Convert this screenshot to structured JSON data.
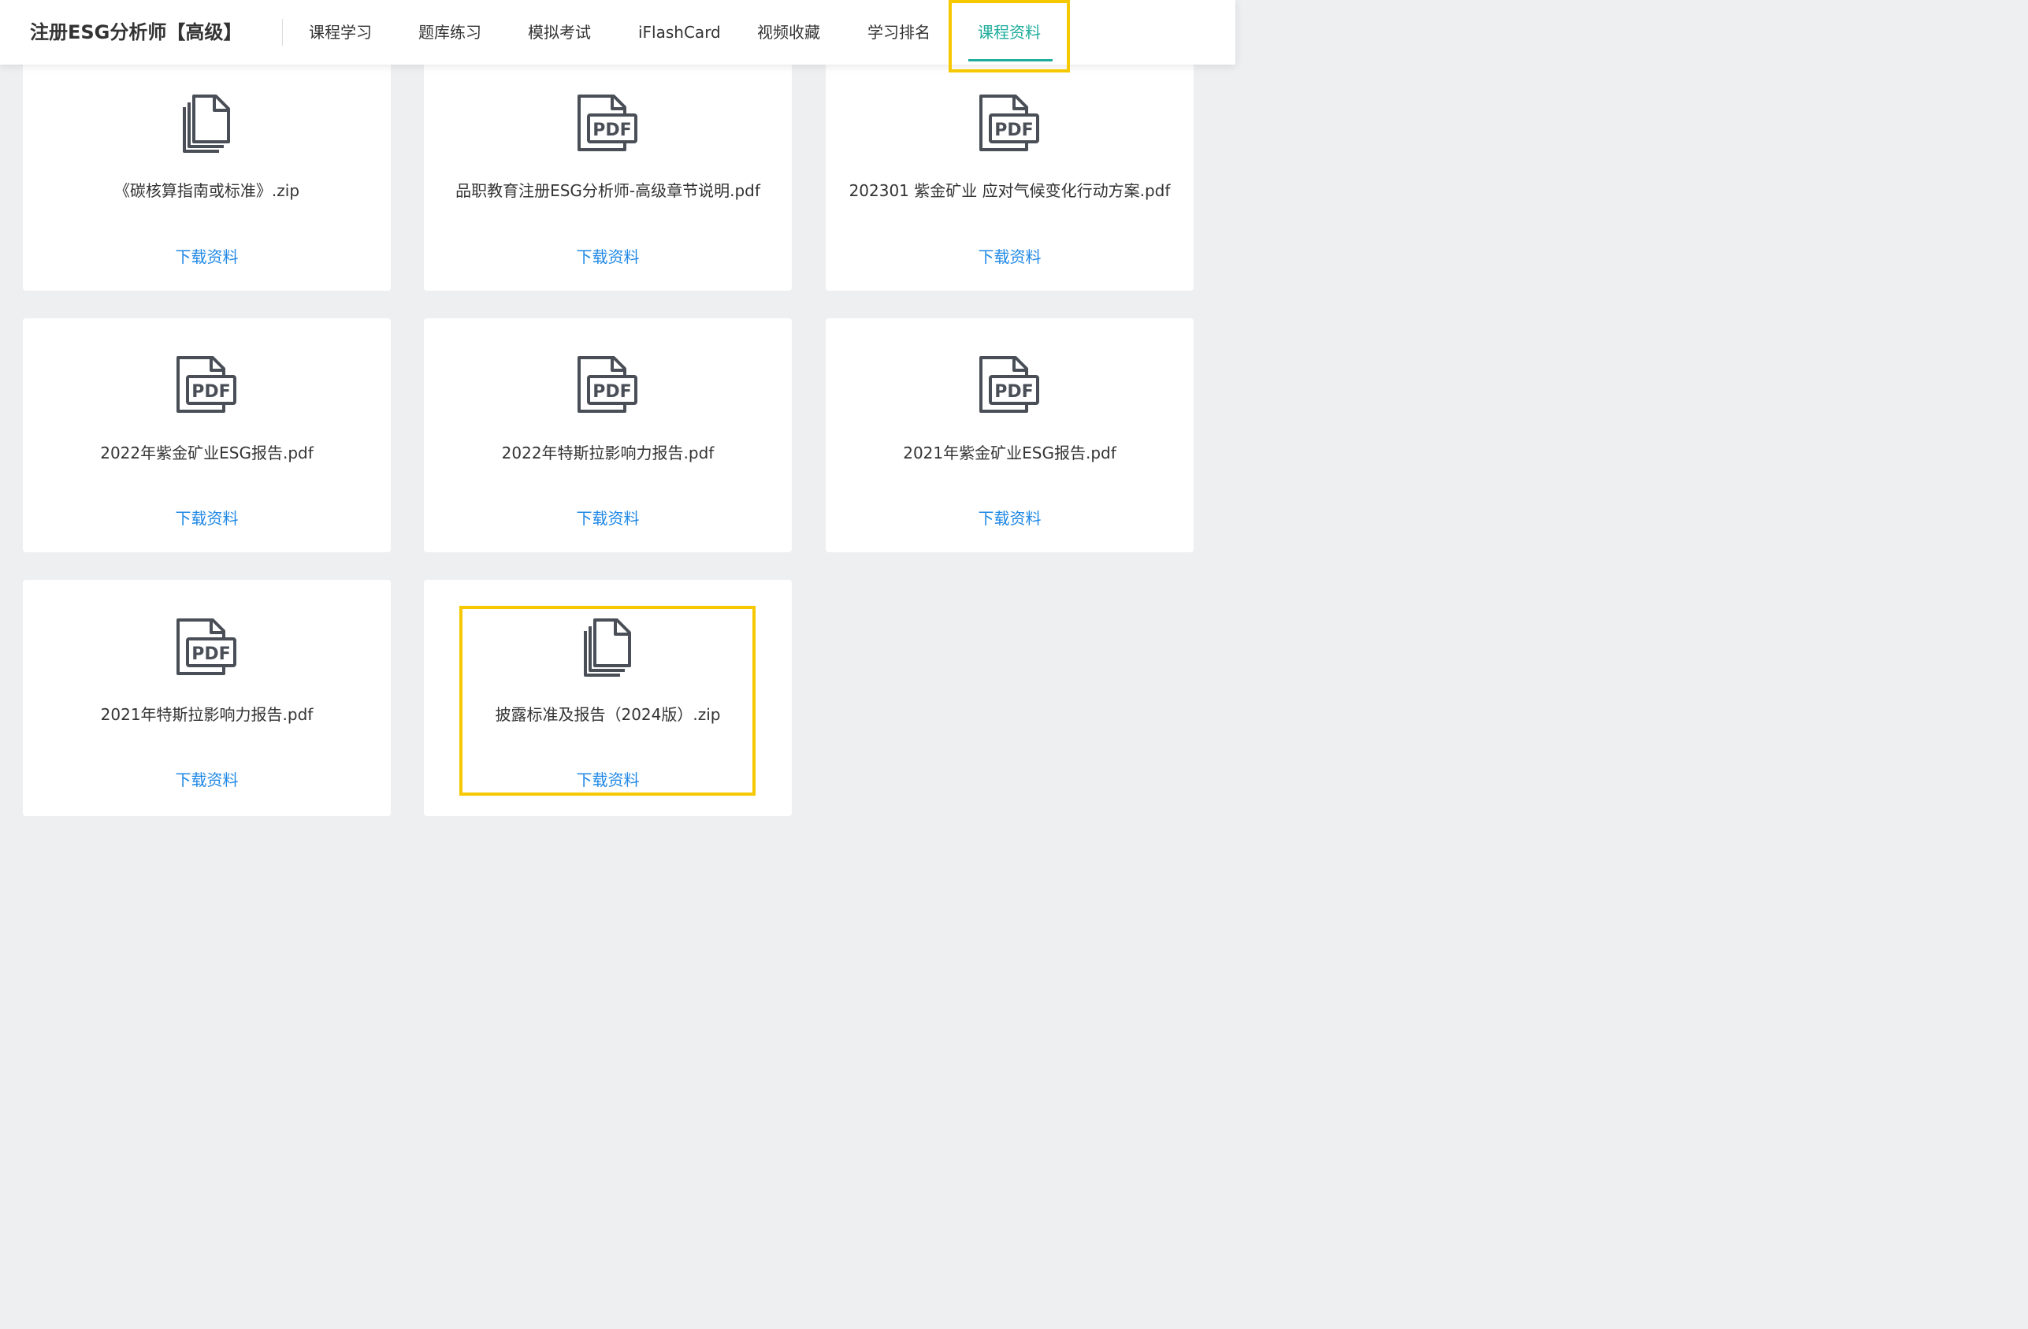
{
  "header": {
    "app_title": "注册ESG分析师【高级】",
    "tabs": [
      {
        "label": "课程学习",
        "active": false
      },
      {
        "label": "题库练习",
        "active": false
      },
      {
        "label": "模拟考试",
        "active": false
      },
      {
        "label": "iFlashCard",
        "active": false
      },
      {
        "label": "视频收藏",
        "active": false
      },
      {
        "label": "学习排名",
        "active": false
      },
      {
        "label": "课程资料",
        "active": true
      }
    ]
  },
  "colors": {
    "accent": "#1fad9b",
    "link": "#1f88e5",
    "highlight": "#f5c800",
    "background": "#eeeff1"
  },
  "materials": [
    {
      "file_name": "《碳核算指南或标准》.zip",
      "icon": "files-stack-icon",
      "download_label": "下载资料"
    },
    {
      "file_name": "品职教育注册ESG分析师-高级章节说明.pdf",
      "icon": "pdf-file-icon",
      "download_label": "下载资料"
    },
    {
      "file_name": "202301 紫金矿业 应对气候变化行动方案.pdf",
      "icon": "pdf-file-icon",
      "download_label": "下载资料"
    },
    {
      "file_name": "2022年紫金矿业ESG报告.pdf",
      "icon": "pdf-file-icon",
      "download_label": "下载资料"
    },
    {
      "file_name": "2022年特斯拉影响力报告.pdf",
      "icon": "pdf-file-icon",
      "download_label": "下载资料"
    },
    {
      "file_name": "2021年紫金矿业ESG报告.pdf",
      "icon": "pdf-file-icon",
      "download_label": "下载资料"
    },
    {
      "file_name": "2021年特斯拉影响力报告.pdf",
      "icon": "pdf-file-icon",
      "download_label": "下载资料"
    },
    {
      "file_name": "披露标准及报告（2024版）.zip",
      "icon": "files-stack-icon",
      "download_label": "下载资料"
    }
  ],
  "icon_text": {
    "pdf": "PDF"
  }
}
